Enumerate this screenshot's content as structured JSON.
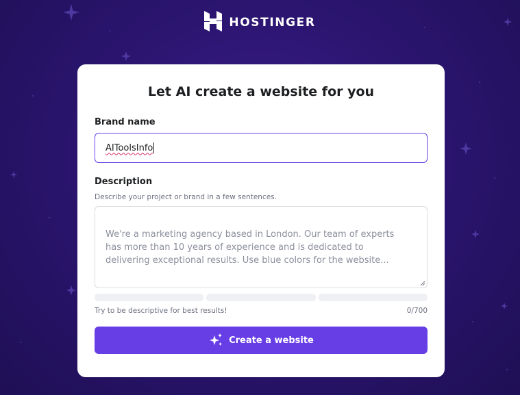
{
  "header": {
    "logo_text": "HOSTINGER",
    "logo_icon": "hostinger-h-icon"
  },
  "form": {
    "title": "Let AI create a website for you",
    "brand_name": {
      "label": "Brand name",
      "value": "AIToolsInfo"
    },
    "description": {
      "label": "Description",
      "helper": "Describe your project or brand in a few sentences.",
      "placeholder": "We're a marketing agency based in London. Our team of experts\nhas more than 10 years of experience and is dedicated to\ndelivering exceptional results. Use blue colors for the website...",
      "hint": "Try to be descriptive for best results!",
      "counter": "0/700"
    },
    "submit": {
      "label": "Create a website",
      "icon": "sparkles-icon"
    }
  },
  "colors": {
    "background": "#2b1570",
    "accent": "#673de6",
    "card": "#ffffff"
  }
}
